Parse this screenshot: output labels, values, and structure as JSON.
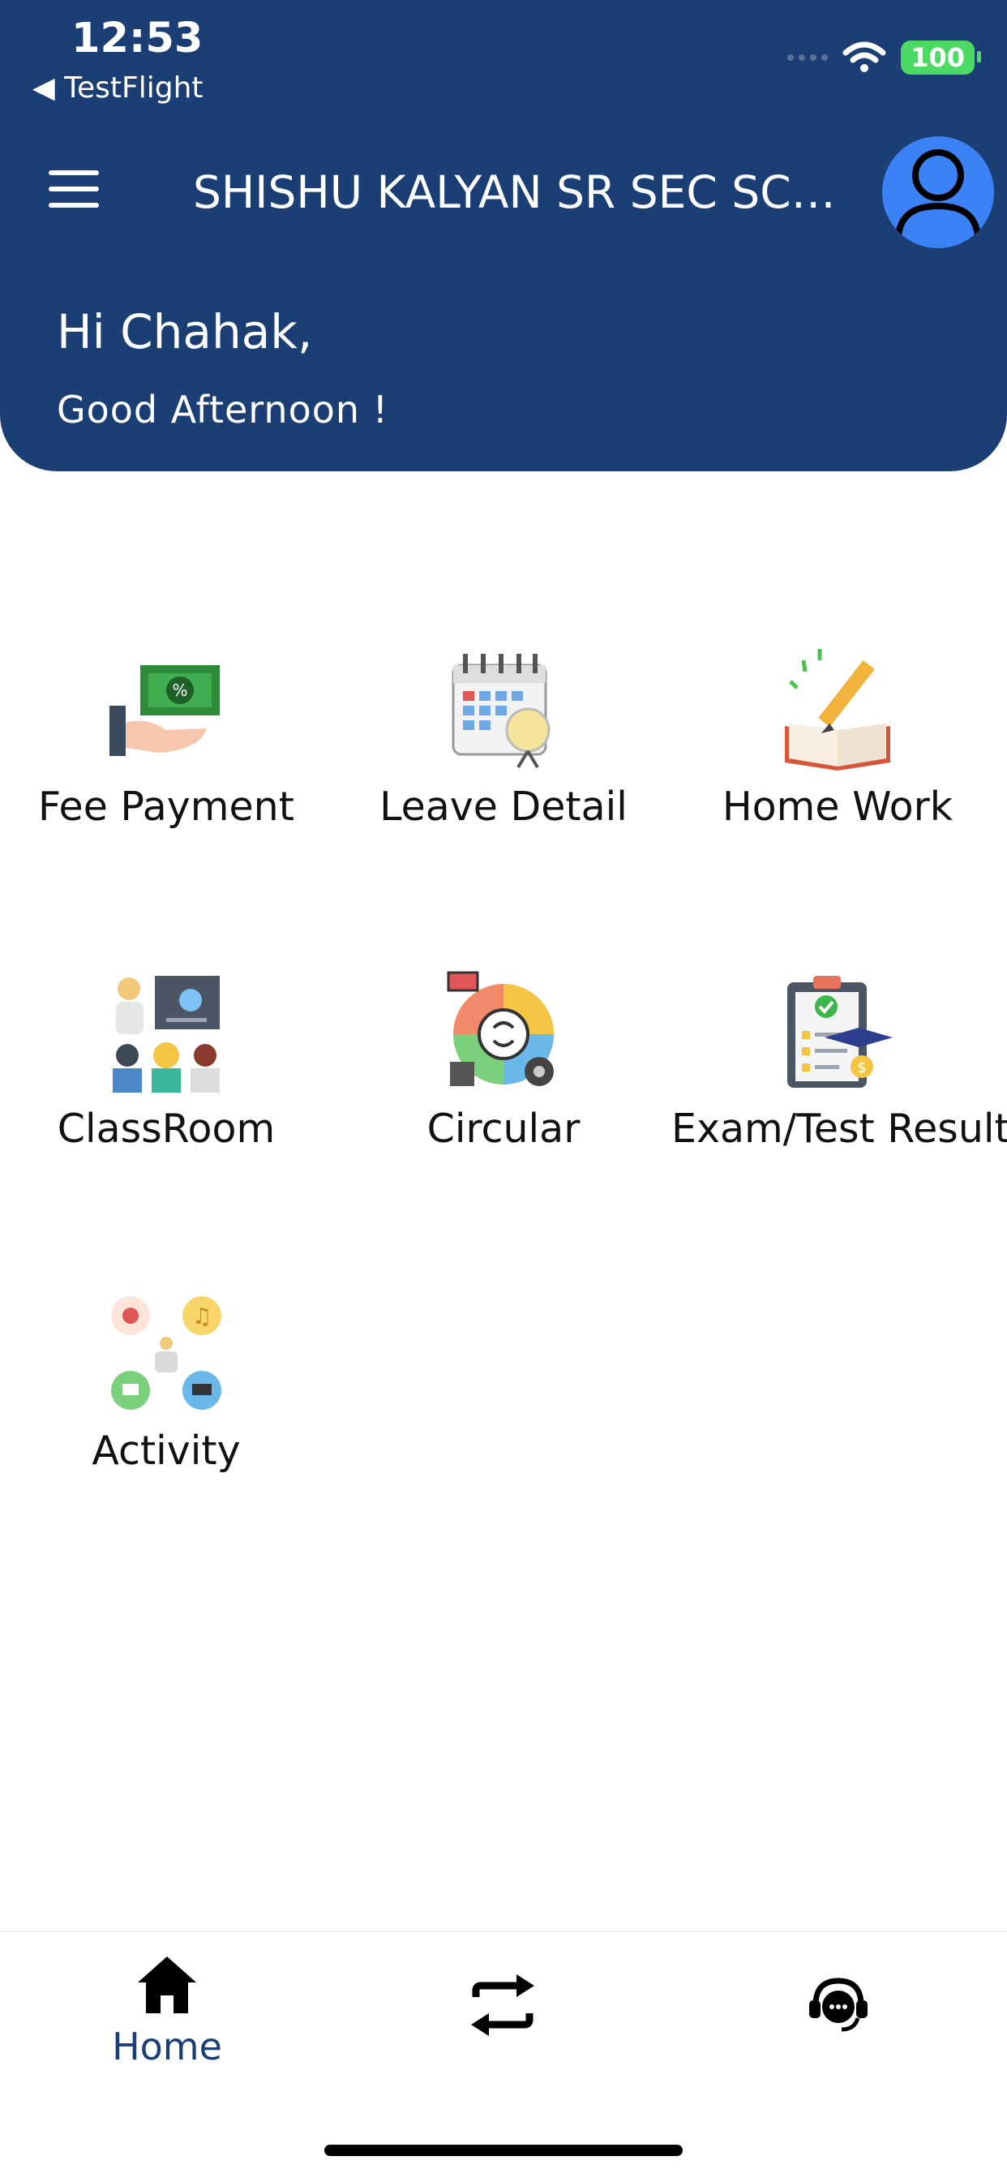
{
  "status_bar": {
    "time": "12:53",
    "back_app": "◀ TestFlight",
    "battery": "100"
  },
  "header": {
    "title": "SHISHU KALYAN SR SEC SCH...",
    "greeting": "Hi Chahak,",
    "subgreeting": "Good Afternoon !"
  },
  "tiles": [
    {
      "label": "Fee Payment",
      "icon": "fee-payment-icon"
    },
    {
      "label": "Leave Detail",
      "icon": "calendar-icon"
    },
    {
      "label": "Home Work",
      "icon": "homework-icon"
    },
    {
      "label": "ClassRoom",
      "icon": "classroom-icon"
    },
    {
      "label": "Circular",
      "icon": "circular-icon"
    },
    {
      "label": "Exam/Test Result",
      "icon": "exam-result-icon"
    },
    {
      "label": "Activity",
      "icon": "activity-icon"
    }
  ],
  "bottom_nav": {
    "home_label": "Home"
  },
  "colors": {
    "brand": "#1b3e75",
    "avatar": "#3b82f6"
  }
}
